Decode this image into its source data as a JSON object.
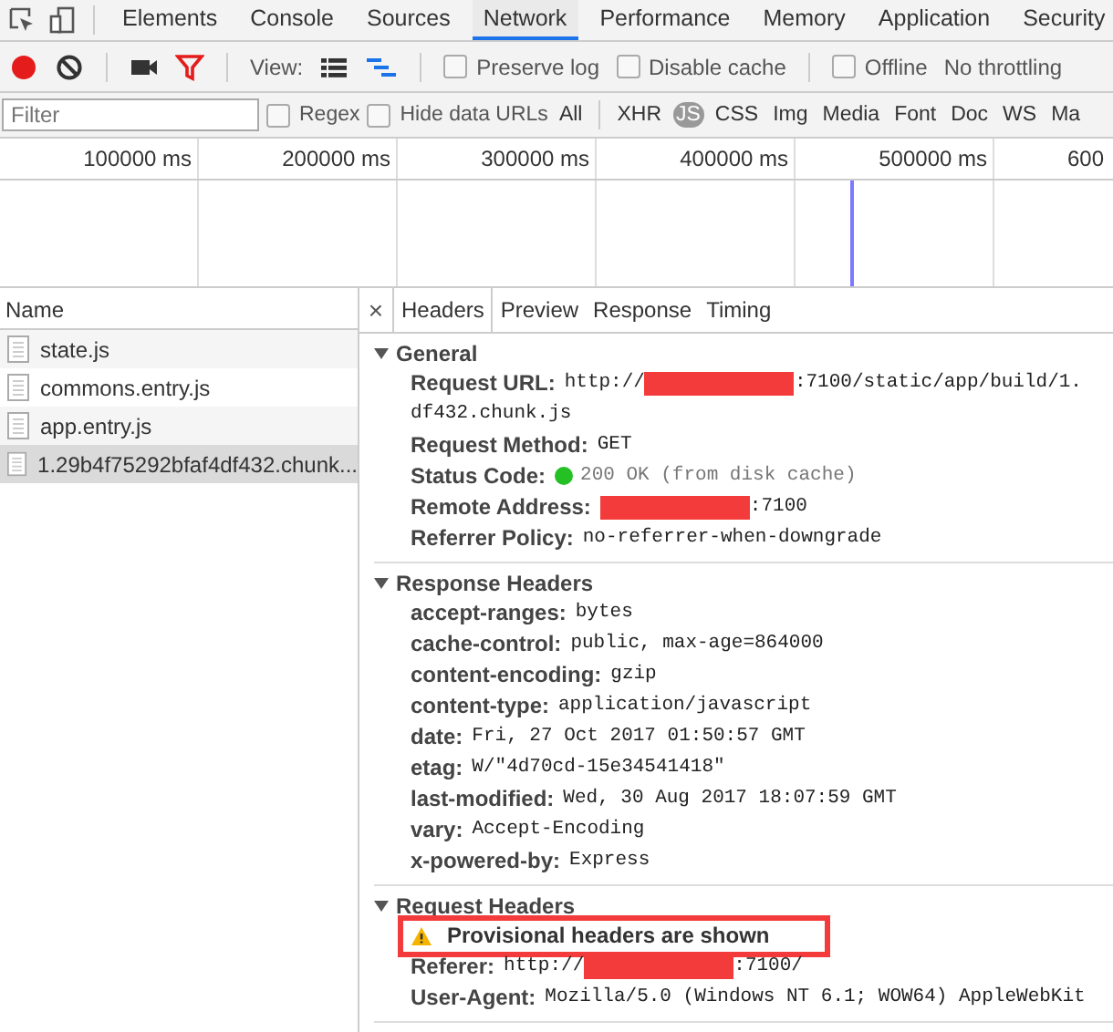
{
  "devtools_tabs": [
    {
      "label": "Elements",
      "selected": false
    },
    {
      "label": "Console",
      "selected": false
    },
    {
      "label": "Sources",
      "selected": false
    },
    {
      "label": "Network",
      "selected": true
    },
    {
      "label": "Performance",
      "selected": false
    },
    {
      "label": "Memory",
      "selected": false
    },
    {
      "label": "Application",
      "selected": false
    },
    {
      "label": "Security",
      "selected": false
    }
  ],
  "toolbar": {
    "recording": true,
    "filter_active": true,
    "view_label": "View:",
    "cache_options": [
      {
        "label": "Preserve log",
        "checked": false
      },
      {
        "label": "Disable cache",
        "checked": false
      }
    ],
    "offline": {
      "label": "Offline",
      "checked": false
    },
    "throttling": "No throttling"
  },
  "filter": {
    "placeholder": "Filter",
    "options": [
      {
        "label": "Regex",
        "checked": false
      },
      {
        "label": "Hide data URLs",
        "checked": false
      }
    ],
    "types": [
      {
        "label": "All",
        "selected": false
      },
      {
        "label": "XHR",
        "selected": false
      },
      {
        "label": "JS",
        "selected": true
      },
      {
        "label": "CSS",
        "selected": false
      },
      {
        "label": "Img",
        "selected": false
      },
      {
        "label": "Media",
        "selected": false
      },
      {
        "label": "Font",
        "selected": false
      },
      {
        "label": "Doc",
        "selected": false
      },
      {
        "label": "WS",
        "selected": false
      },
      {
        "label": "Ma",
        "selected": false
      }
    ]
  },
  "timeline": {
    "ticks": [
      "100000 ms",
      "200000 ms",
      "300000 ms",
      "400000 ms",
      "500000 ms",
      "600"
    ]
  },
  "requests": {
    "column": "Name",
    "rows": [
      {
        "name": "state.js",
        "selected": false
      },
      {
        "name": "commons.entry.js",
        "selected": false
      },
      {
        "name": "app.entry.js",
        "selected": false
      },
      {
        "name": "1.29b4f75292bfaf4df432.chunk...",
        "selected": true
      }
    ]
  },
  "details": {
    "close": "×",
    "tabs": [
      {
        "label": "Headers",
        "selected": true
      },
      {
        "label": "Preview",
        "selected": false
      },
      {
        "label": "Response",
        "selected": false
      },
      {
        "label": "Timing",
        "selected": false
      }
    ],
    "sections": [
      {
        "title": "General",
        "expanded": true,
        "rows": [
          {
            "kind": "plain",
            "key": "Request URL:",
            "value": [
              {
                "kind": "text",
                "text": "http://"
              },
              {
                "kind": "redacted"
              },
              {
                "kind": "text",
                "text": ":7100/static/app/build/1."
              },
              {
                "kind": "break"
              },
              {
                "kind": "text",
                "text": "df432.chunk.js"
              }
            ]
          },
          {
            "kind": "plain",
            "key": "Request Method:",
            "value": [
              {
                "kind": "text",
                "text": "GET"
              }
            ]
          },
          {
            "kind": "status",
            "key": "Status Code:",
            "value": [
              {
                "kind": "text",
                "text": "200 OK (from disk cache)"
              }
            ]
          },
          {
            "kind": "plain",
            "key": "Remote Address:",
            "value": [
              {
                "kind": "redacted"
              },
              {
                "kind": "text",
                "text": ":7100"
              }
            ]
          },
          {
            "kind": "plain",
            "key": "Referrer Policy:",
            "value": [
              {
                "kind": "text",
                "text": "no-referrer-when-downgrade"
              }
            ]
          }
        ]
      },
      {
        "title": "Response Headers",
        "expanded": true,
        "rows": [
          {
            "kind": "plain",
            "key": "accept-ranges:",
            "value": [
              {
                "kind": "text",
                "text": "bytes"
              }
            ]
          },
          {
            "kind": "plain",
            "key": "cache-control:",
            "value": [
              {
                "kind": "text",
                "text": "public, max-age=864000"
              }
            ]
          },
          {
            "kind": "plain",
            "key": "content-encoding:",
            "value": [
              {
                "kind": "text",
                "text": "gzip"
              }
            ]
          },
          {
            "kind": "plain",
            "key": "content-type:",
            "value": [
              {
                "kind": "text",
                "text": "application/javascript"
              }
            ]
          },
          {
            "kind": "plain",
            "key": "date:",
            "value": [
              {
                "kind": "text",
                "text": "Fri, 27 Oct 2017 01:50:57 GMT"
              }
            ]
          },
          {
            "kind": "plain",
            "key": "etag:",
            "value": [
              {
                "kind": "text",
                "text": "W/\"4d70cd-15e34541418\""
              }
            ]
          },
          {
            "kind": "plain",
            "key": "last-modified:",
            "value": [
              {
                "kind": "text",
                "text": "Wed, 30 Aug 2017 18:07:59 GMT"
              }
            ]
          },
          {
            "kind": "plain",
            "key": "vary:",
            "value": [
              {
                "kind": "text",
                "text": "Accept-Encoding"
              }
            ]
          },
          {
            "kind": "plain",
            "key": "x-powered-by:",
            "value": [
              {
                "kind": "text",
                "text": "Express"
              }
            ]
          }
        ]
      },
      {
        "title": "Request Headers",
        "expanded": true,
        "rows": [
          {
            "kind": "warning",
            "text": "Provisional headers are shown",
            "highlighted": true
          },
          {
            "kind": "plain",
            "key": "Referer:",
            "value": [
              {
                "kind": "text",
                "text": "http://"
              },
              {
                "kind": "redacted"
              },
              {
                "kind": "text",
                "text": ":7100/"
              }
            ]
          },
          {
            "kind": "plain",
            "key": "User-Agent:",
            "value": [
              {
                "kind": "text",
                "text": "Mozilla/5.0 (Windows NT 6.1; WOW64) AppleWebKit"
              }
            ]
          }
        ]
      }
    ]
  }
}
